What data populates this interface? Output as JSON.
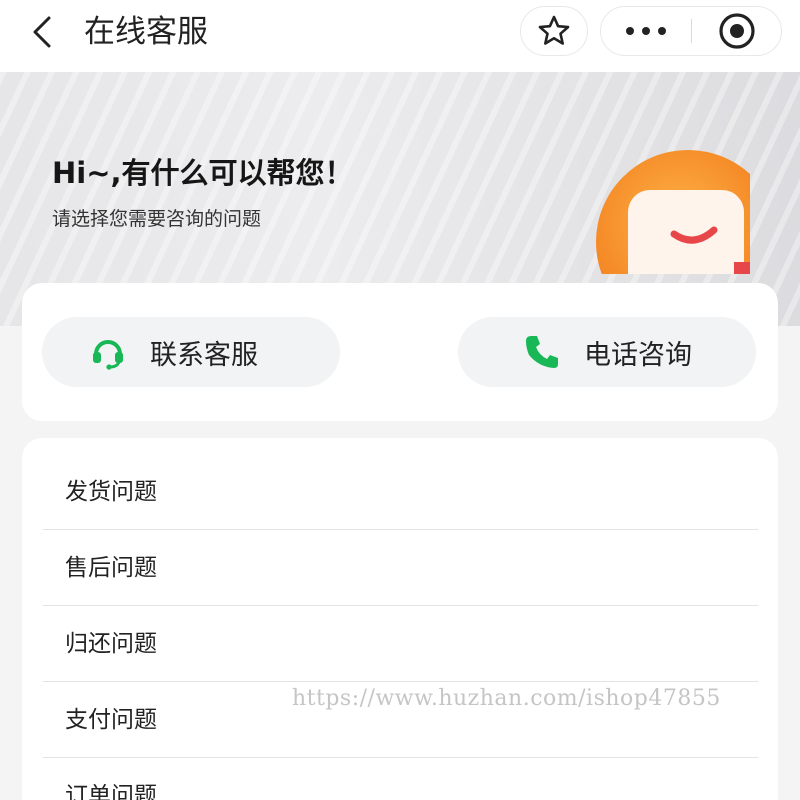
{
  "header": {
    "title": "在线客服",
    "icons": {
      "back": "back-arrow-icon",
      "favorite": "star-icon",
      "more": "more-dots-icon",
      "close": "target-circle-icon"
    }
  },
  "banner": {
    "title": "Hi~,有什么可以帮您！",
    "subtitle": "请选择您需要咨询的问题",
    "mascot_icon": "orange-chat-bubble-icon"
  },
  "contact": {
    "service_label": "联系客服",
    "service_icon": "headset-icon",
    "phone_label": "电话咨询",
    "phone_icon": "phone-icon"
  },
  "questions": [
    {
      "label": "发货问题"
    },
    {
      "label": "售后问题"
    },
    {
      "label": "归还问题"
    },
    {
      "label": "支付问题"
    },
    {
      "label": "订单问题"
    }
  ],
  "watermark": "https://www.huzhan.com/ishop47855",
  "colors": {
    "accent_green": "#17b855",
    "mascot_orange": "#f59a2a",
    "mascot_red": "#e8474a"
  }
}
